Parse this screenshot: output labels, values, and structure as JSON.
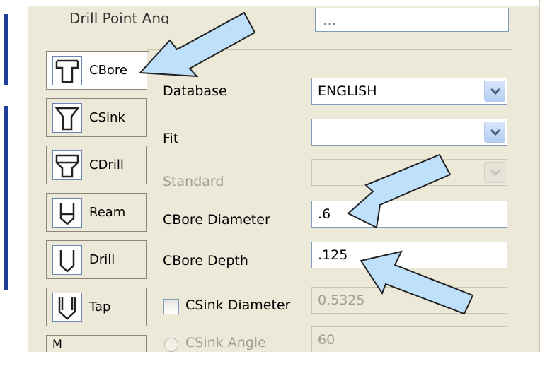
{
  "top_field": {
    "label": "Drill Point Ang",
    "label_underline": "P",
    "value": "···"
  },
  "tabs": [
    {
      "label": "CBore",
      "icon": "counterbore-icon",
      "active": true
    },
    {
      "label": "CSink",
      "icon": "countersink-icon",
      "active": false
    },
    {
      "label": "CDrill",
      "icon": "counterdrill-icon",
      "active": false
    },
    {
      "label": "Ream",
      "icon": "ream-icon",
      "active": false
    },
    {
      "label": "Drill",
      "icon": "drill-icon",
      "active": false
    },
    {
      "label": "Tap",
      "icon": "tap-icon",
      "active": false
    },
    {
      "label": "M",
      "icon": "more-icon",
      "active": false
    }
  ],
  "form": {
    "database": {
      "label": "Database",
      "value": "ENGLISH"
    },
    "fit": {
      "label": "Fit",
      "value": ""
    },
    "standard": {
      "label": "Standard",
      "value": ""
    },
    "cbore_diameter": {
      "label": "CBore Diameter",
      "value": ".6"
    },
    "cbore_depth": {
      "label": "CBore Depth",
      "value": ".125"
    },
    "csink_diameter": {
      "label": "CSink Diameter",
      "value": "0.5325",
      "checked": false
    },
    "csink_angle": {
      "label": "CSink Angle",
      "value": "60"
    }
  },
  "colors": {
    "dialog_bg": "#ece9d8",
    "field_border": "#7f9db9",
    "arrow_fill": "#bfe0fb",
    "disabled_text": "#a0a08f"
  }
}
